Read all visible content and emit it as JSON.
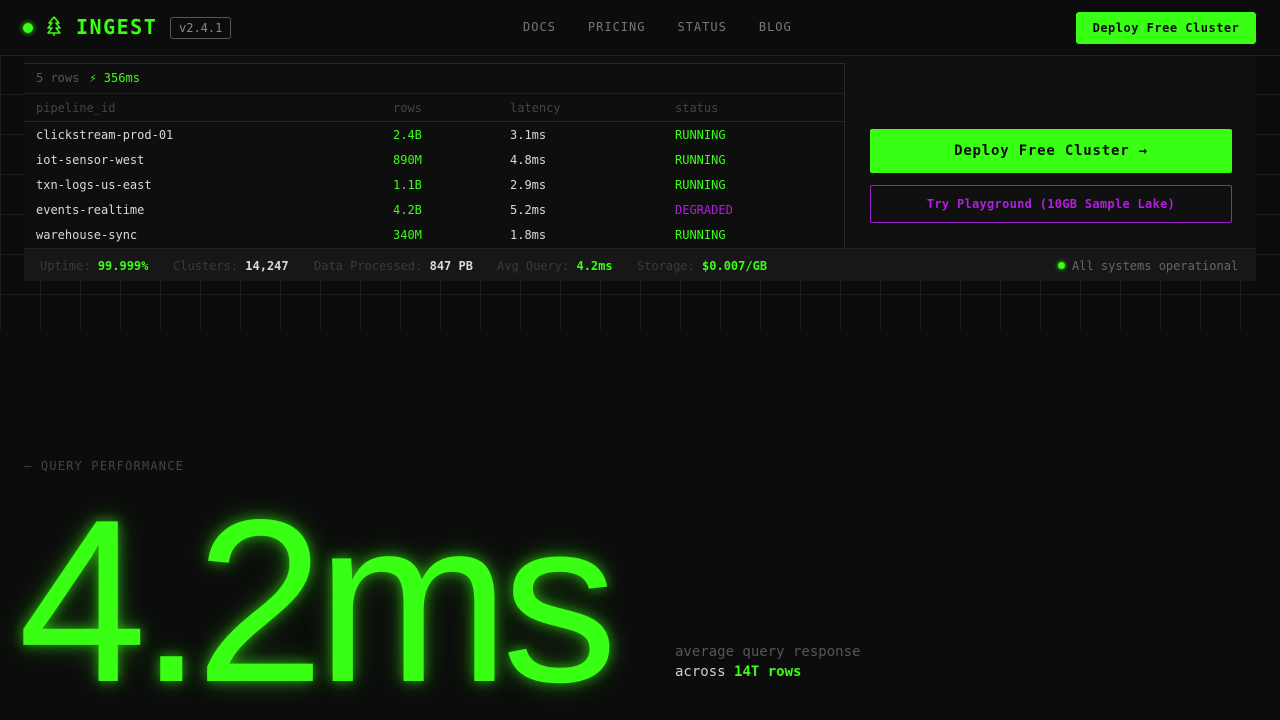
{
  "brand": {
    "name": "INGEST",
    "version": "v2.4.1"
  },
  "nav": {
    "links": [
      "DOCS",
      "PRICING",
      "STATUS",
      "BLOG"
    ],
    "cta": "Deploy Free Cluster"
  },
  "table": {
    "row_count": "5 rows",
    "query_time": "⚡ 356ms",
    "headers": [
      "pipeline_id",
      "rows",
      "latency",
      "status"
    ],
    "rows": [
      {
        "id": "clickstream-prod-01",
        "rows": "2.4B",
        "latency": "3.1ms",
        "status": "RUNNING"
      },
      {
        "id": "iot-sensor-west",
        "rows": "890M",
        "latency": "4.8ms",
        "status": "RUNNING"
      },
      {
        "id": "txn-logs-us-east",
        "rows": "1.1B",
        "latency": "2.9ms",
        "status": "RUNNING"
      },
      {
        "id": "events-realtime",
        "rows": "4.2B",
        "latency": "5.2ms",
        "status": "DEGRADED"
      },
      {
        "id": "warehouse-sync",
        "rows": "340M",
        "latency": "1.8ms",
        "status": "RUNNING"
      }
    ]
  },
  "cta": {
    "primary": "Deploy Free Cluster →",
    "secondary": "Try Playground (10GB Sample Lake)"
  },
  "stats": {
    "uptime_label": "Uptime:",
    "uptime": "99.999%",
    "clusters_label": "Clusters:",
    "clusters": "14,247",
    "data_label": "Data Processed:",
    "data": "847 PB",
    "avg_label": "Avg Query:",
    "avg": "4.2ms",
    "storage_label": "Storage:",
    "storage": "$0.007/GB",
    "system_status": "All systems operational"
  },
  "hero": {
    "section_label": "— QUERY PERFORMANCE",
    "metric": "4.2ms",
    "caption_line1": "average query response",
    "caption_prefix": "across",
    "caption_highlight": "14T rows"
  },
  "colors": {
    "accent": "#39ff14",
    "degraded": "#b21ee0",
    "background": "#0c0c0c"
  },
  "icons": {
    "logo": "tree-icon",
    "status": "status-dot-icon"
  }
}
